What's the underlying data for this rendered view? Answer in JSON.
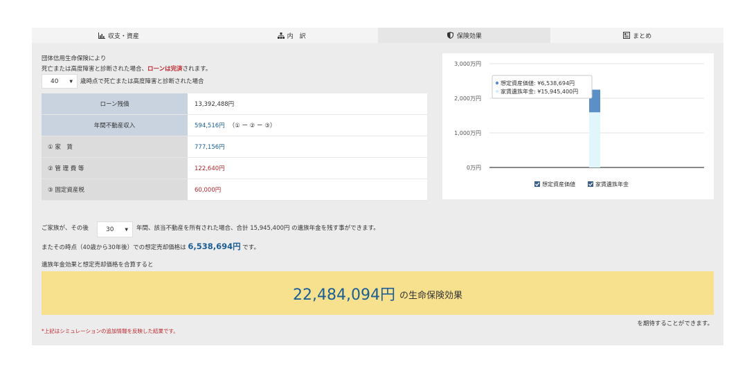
{
  "tabs": [
    {
      "label": "収支・資産",
      "icon": "bar-chart-icon"
    },
    {
      "label": "内　訳",
      "icon": "sitemap-icon"
    },
    {
      "label": "保険効果",
      "icon": "shield-icon",
      "active": true
    },
    {
      "label": "まとめ",
      "icon": "summary-icon"
    }
  ],
  "intro": {
    "line1": "団体信用生命保険により",
    "line2_pre": "死亡または高度障害と診断された場合、",
    "line2_red": "ローンは完済",
    "line2_post": "されます。"
  },
  "age_select": {
    "value": "40",
    "label": "歳時点で死亡または高度障害と診断された場合"
  },
  "table": {
    "rows": [
      {
        "key": "ローン残債",
        "value": "13,392,488円"
      },
      {
        "key": "年間不動産収入",
        "value": "594,516円",
        "note": "（① ー ② ー ③）"
      },
      {
        "key": "① 家　賃",
        "value": "777,156円"
      },
      {
        "key": "② 管 理 費 等",
        "value": "122,640円"
      },
      {
        "key": "③ 固定資産税",
        "value": "60,000円"
      }
    ]
  },
  "chart_data": {
    "type": "bar",
    "y_ticks": [
      "3,000万円",
      "2,000万円",
      "1,000万円",
      "0万円"
    ],
    "ylim": [
      0,
      3000
    ],
    "y_unit": "万円",
    "series": [
      {
        "name": "想定資産価値",
        "value": 6538694,
        "color": "#5b8fc7"
      },
      {
        "name": "家賃遺族年金",
        "value": 15945400,
        "color": "#e0f6fb"
      }
    ],
    "tooltip": {
      "line1": "想定資産価値: ¥6,538,694円",
      "line2": "家賃遺族年金: ¥15,945,400円"
    },
    "legend": [
      "想定資産価値",
      "家賃遺族年金"
    ]
  },
  "bottom": {
    "line1_pre": "ご家族が、その後",
    "years_value": "30",
    "line1_mid": "年間、該当不動産を所有された場合、合計",
    "line1_big": "15,945,400円",
    "line1_post": "の遺族年金を残す事ができます。",
    "line2_pre": "またその時点（40歳から30年後）での想定売却価格は",
    "line2_big": "6,538,694円",
    "line2_post": "です。",
    "line3": "遺族年金効果と想定売却価格を合算すると",
    "result_amount": "22,484,094円",
    "result_suffix": "の生命保険効果",
    "expect": "を期待することができます。",
    "footnote": "*上記はシミュレーションの追加情報を反映した結果です。"
  },
  "colors": {
    "accent": "#1a5e94",
    "red": "#c0262d",
    "highlight": "#f7e18f"
  }
}
